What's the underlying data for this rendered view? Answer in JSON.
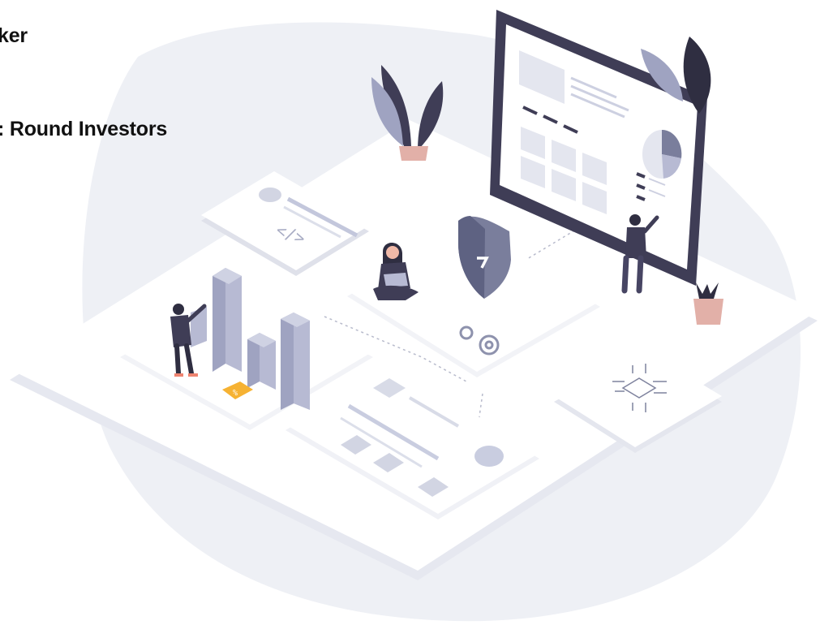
{
  "heading_1": "ker",
  "heading_2": ": Round Investors",
  "illustration": {
    "code_icon": "</>",
    "badge_symbol": "%",
    "colors": {
      "blob": "#eef0f5",
      "platform": "#ffffff",
      "primary": "#3f3d56",
      "accent": "#9fa3c1",
      "light": "#e4e6ef",
      "bars": "#b7bad3",
      "badge": "#f6b233",
      "pot": "#e2b0a8"
    }
  }
}
